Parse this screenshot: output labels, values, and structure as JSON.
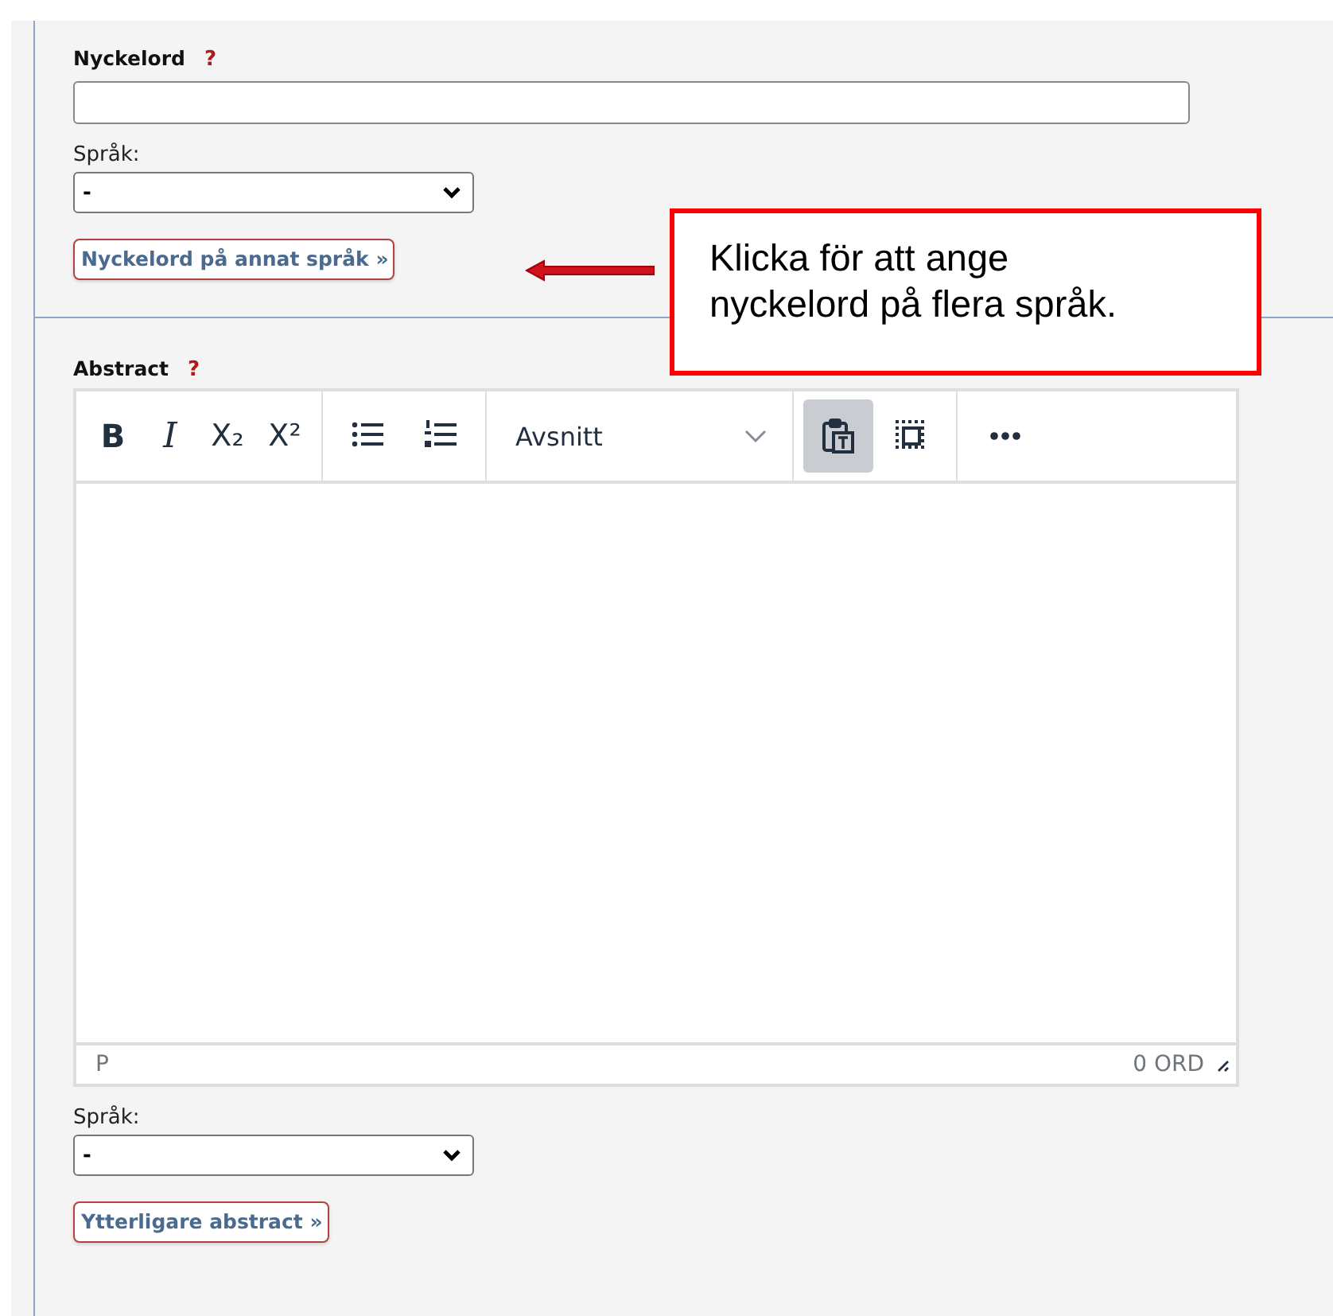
{
  "keywords": {
    "label": "Nyckelord",
    "help": "?",
    "language": {
      "label": "Språk:",
      "value": "-"
    },
    "more_button": "Nyckelord på annat språk »"
  },
  "abstract": {
    "label": "Abstract",
    "help": "?",
    "toolbar": [
      [
        {
          "kind": "bold",
          "label": "B",
          "pressed": false
        },
        {
          "kind": "italic",
          "label": "I",
          "pressed": false
        },
        {
          "kind": "subscript",
          "label": "X₂",
          "pressed": false
        },
        {
          "kind": "superscript",
          "label": "X²",
          "pressed": false
        }
      ],
      [
        {
          "kind": "bullet-list",
          "pressed": false
        },
        {
          "kind": "numbered-list",
          "pressed": false
        }
      ],
      [
        {
          "kind": "format-select",
          "label": "Avsnitt",
          "pressed": false
        }
      ],
      [
        {
          "kind": "paste-text",
          "pressed": true
        },
        {
          "kind": "select-all",
          "pressed": false
        }
      ],
      [
        {
          "kind": "more",
          "pressed": false
        }
      ]
    ],
    "status_path": "P",
    "word_count": "0 ORD",
    "language": {
      "label": "Språk:",
      "value": "-"
    },
    "more_button": "Ytterligare abstract »"
  },
  "callout": {
    "text": "Klicka för att ange\nnyckelord på flera språk."
  }
}
